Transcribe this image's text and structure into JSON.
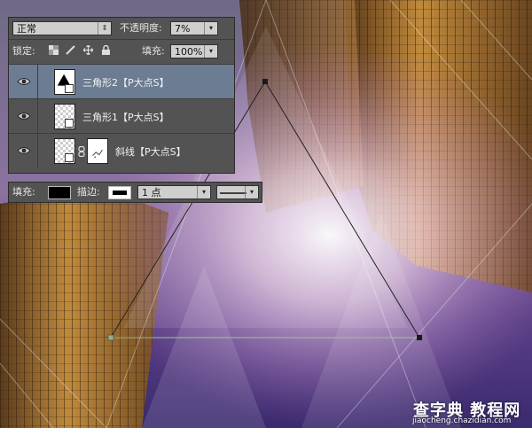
{
  "blend": {
    "mode": "正常",
    "opacity_label": "不透明度:",
    "opacity": "7%"
  },
  "lock": {
    "label": "锁定:",
    "fill_label": "填充:",
    "fill": "100%"
  },
  "layers": [
    {
      "name": "三角形2【P大点S】",
      "selected": true,
      "thumb_icon": "triangle-shape-icon"
    },
    {
      "name": "三角形1【P大点S】",
      "selected": false,
      "thumb_icon": "shape-layer-icon"
    },
    {
      "name": "斜线【P大点S】",
      "selected": false,
      "thumb_icon": "masked-layer-icon"
    }
  ],
  "options": {
    "fill_label": "填充:",
    "stroke_label": "描边:",
    "stroke_width": "1 点",
    "fill_color": "#000000",
    "stroke_color": "#ffffff"
  },
  "watermark": {
    "text": "查字典 教程网",
    "url": "jiaocheng.chazidian.com"
  },
  "colors": {
    "panel": "#535353",
    "selected_layer": "#6c7c93",
    "path_stroke": "#222222"
  }
}
